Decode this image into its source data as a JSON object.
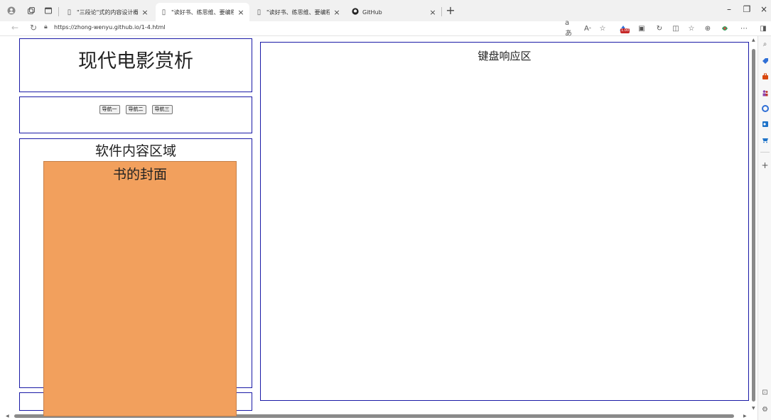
{
  "browser": {
    "tabs": [
      {
        "title": "\"三段论\"式的内容设计概要",
        "active": false
      },
      {
        "title": "\"读好书、练思维、要编程\"",
        "active": true
      },
      {
        "title": "\"读好书、练思维、要编程\"",
        "active": false
      },
      {
        "title": "GitHub",
        "active": false
      }
    ],
    "new_tab_symbol": "+",
    "url": "https://zhong-wenyu.github.io/1-4.html",
    "toolbar_badge": "1.00"
  },
  "page": {
    "header_title": "现代电影赏析",
    "nav_buttons": [
      "导航一",
      "导航二",
      "导航三"
    ],
    "content_title": "软件内容区域",
    "book_cover_title": "书的封面",
    "keyboard_title": "键盘响应区"
  },
  "colors": {
    "box_border": "#1a1aa6",
    "book_cover_fill": "#f2a05d"
  },
  "icons": {
    "browser_left": [
      "profile-icon",
      "workspaces-icon",
      "tab-actions-icon"
    ],
    "toolbar": [
      "read-aloud-icon",
      "immersive-reader-icon",
      "favorite-icon",
      "extension-icon",
      "collections-icon",
      "refresh-icon",
      "split-screen-icon",
      "favorites-icon",
      "browser-essentials-icon",
      "copilot-icon",
      "more-icon",
      "sidebar-toggle-icon"
    ],
    "sidebar": [
      "search-icon",
      "shopping-tag-icon",
      "tools-icon",
      "people-icon",
      "office-icon",
      "outlook-icon",
      "shopping-icon",
      "add-icon",
      "screenshot-icon",
      "settings-icon"
    ]
  }
}
